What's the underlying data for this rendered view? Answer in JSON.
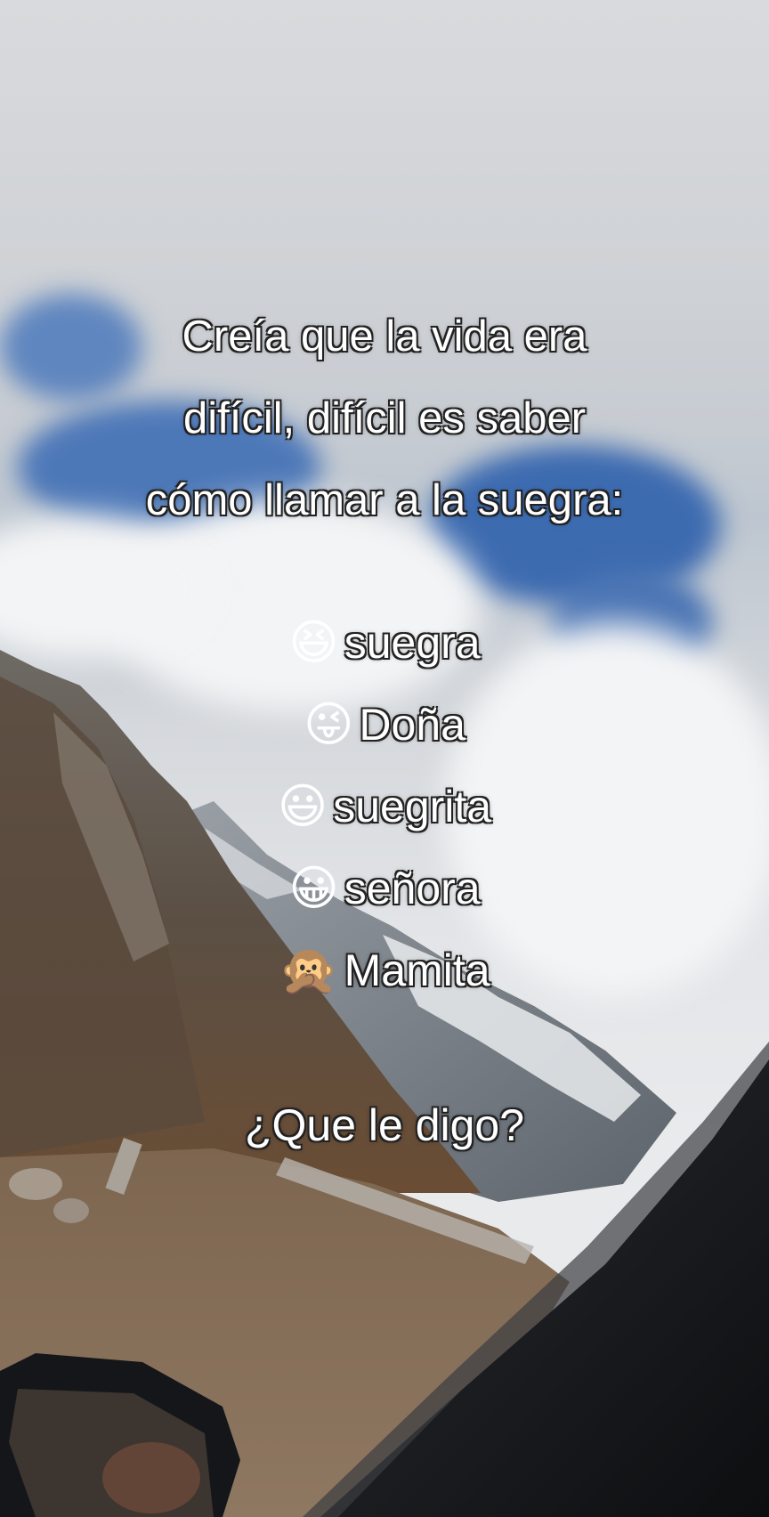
{
  "caption": {
    "lines": [
      "Creía que la vida era",
      "difícil, difícil es saber",
      "cómo llamar a la suegra:"
    ]
  },
  "options": [
    {
      "emoji": "😆",
      "label": "suegra"
    },
    {
      "emoji": "😜",
      "label": "Doña"
    },
    {
      "emoji": "😃",
      "label": "suegrita"
    },
    {
      "emoji": "😀",
      "label": "señora"
    },
    {
      "emoji": "🙊",
      "label": "Mamita"
    }
  ],
  "question": "¿Que le digo?"
}
